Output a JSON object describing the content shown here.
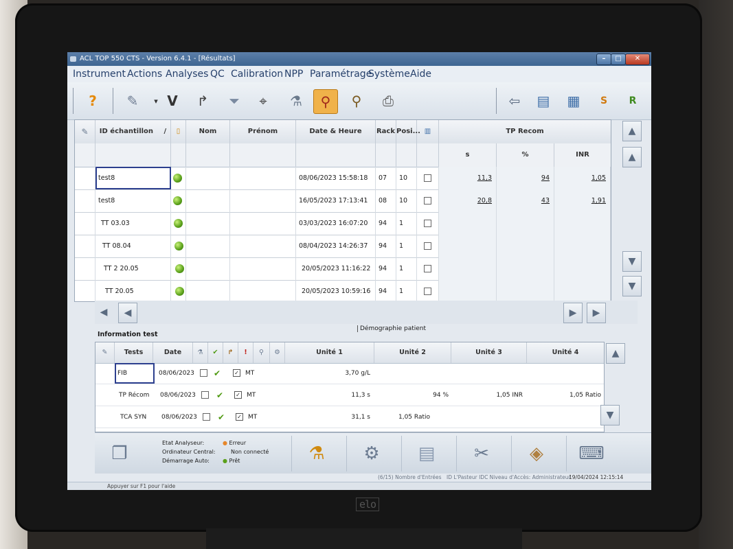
{
  "window": {
    "title": "ACL TOP 550 CTS - Version 6.4.1 - [Résultats]"
  },
  "menu": [
    "Instrument",
    "Actions",
    "Analyses",
    "QC",
    "Calibration",
    "NPP",
    "Paramétrage",
    "Système",
    "Aide"
  ],
  "toolbar": {
    "left_icons": [
      "help-icon",
      "edit-icon",
      "validate-icon",
      "redo-icon",
      "filter-icon",
      "binoculars-icon",
      "reagent-icon",
      "sample-search-icon",
      "patient-search-icon",
      "print-icon"
    ],
    "right_icons": [
      "back-icon",
      "list-icon",
      "report-icon",
      "s-report-icon",
      "r-report-icon"
    ],
    "validate_glyph": "V"
  },
  "results_table": {
    "columns": {
      "id": "ID échantillon",
      "sort": "/",
      "nom": "Nom",
      "prenom": "Prénom",
      "date": "Date & Heure",
      "rack": "Rack",
      "pos": "Posi...",
      "group": "TP Recom",
      "s": "s",
      "pct": "%",
      "inr": "INR"
    },
    "rows": [
      {
        "id": "test8",
        "date": "08/06/2023 15:58:18",
        "rack": "07",
        "pos": "10",
        "s": "11,3",
        "pct": "94",
        "inr": "1,05"
      },
      {
        "id": "test8",
        "date": "16/05/2023 17:13:41",
        "rack": "08",
        "pos": "10",
        "s": "20,8",
        "pct": "43",
        "inr": "1,91"
      },
      {
        "id": "TT 03.03",
        "date": "03/03/2023 16:07:20",
        "rack": "94",
        "pos": "1",
        "s": "",
        "pct": "",
        "inr": ""
      },
      {
        "id": "TT 08.04",
        "date": "08/04/2023 14:26:37",
        "rack": "94",
        "pos": "1",
        "s": "",
        "pct": "",
        "inr": ""
      },
      {
        "id": "TT 2 20.05",
        "date": "20/05/2023 11:16:22",
        "rack": "94",
        "pos": "1",
        "s": "",
        "pct": "",
        "inr": ""
      },
      {
        "id": "TT 20.05",
        "date": "20/05/2023 10:59:16",
        "rack": "94",
        "pos": "1",
        "s": "",
        "pct": "",
        "inr": ""
      }
    ]
  },
  "info": {
    "title": "Information test",
    "tab": "Démographie patient",
    "columns": {
      "tests": "Tests",
      "date": "Date",
      "flag": "!",
      "u1": "Unité 1",
      "u2": "Unité 2",
      "u3": "Unité 3",
      "u4": "Unité 4"
    },
    "rows": [
      {
        "test": "FIB",
        "date": "08/06/2023",
        "mt": "MT",
        "u1": "3,70 g/L",
        "u2": "",
        "u3": "",
        "u4": ""
      },
      {
        "test": "TP Récom",
        "date": "08/06/2023",
        "mt": "MT",
        "u1": "11,3 s",
        "u2": "94 %",
        "u3": "1,05 INR",
        "u4": "1,05 Ratio"
      },
      {
        "test": "TCA SYN",
        "date": "08/06/2023",
        "mt": "MT",
        "u1": "31,1 s",
        "u2": "1,05 Ratio",
        "u3": "",
        "u4": ""
      }
    ]
  },
  "status_panel": {
    "etat_label": "Etat Analyseur:",
    "etat_value": "Erreur",
    "ordi_label": "Ordinateur Central:",
    "ordi_value": "Non connecté",
    "demarrage_label": "Démarrage Auto:",
    "demarrage_value": "Prêt"
  },
  "statusbar": {
    "hint": "Appuyer sur F1 pour l'aide",
    "entries": "(6/15) Nombre d'Entrées",
    "user": "ID L'Pasteur IDC Niveau d'Accès: Administrateur",
    "datetime": "19/04/2024 12:15:14"
  },
  "colors": {
    "titlebar": "#3e6591",
    "selected_tool": "#f0b24a",
    "status_ok": "#5aa01a",
    "status_error": "#e6872b"
  }
}
